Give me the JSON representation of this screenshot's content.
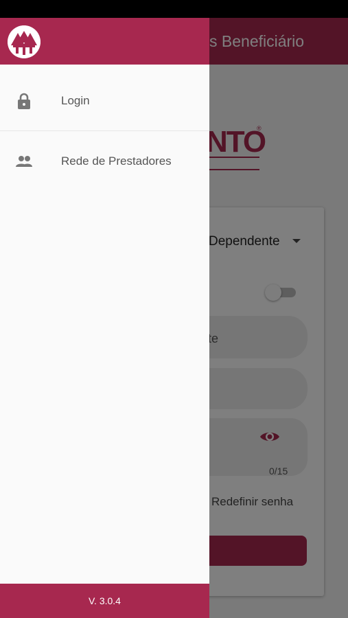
{
  "appbar": {
    "title": "s Beneficiário"
  },
  "background": {
    "logo_text": "NTO",
    "logo_mark": "®",
    "user_type_select": "Dependente",
    "field_placeholder": "te",
    "password_counter": "0/15",
    "reset_password_link": "Redefinir senha",
    "eye_icon": "eye-icon"
  },
  "drawer": {
    "items": [
      {
        "label": "Login",
        "icon": "lock-icon"
      },
      {
        "label": "Rede de Prestadores",
        "icon": "people-icon"
      }
    ],
    "version": "V. 3.0.4"
  },
  "colors": {
    "brand": "#a7284f",
    "drawer_bg": "#fafafa",
    "scrim": "rgba(0,0,0,0.5)"
  }
}
